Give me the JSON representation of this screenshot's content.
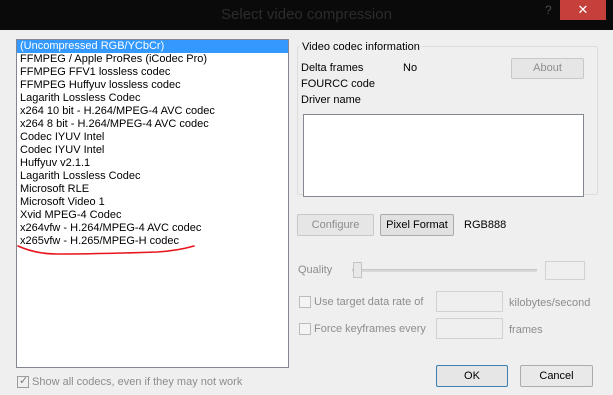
{
  "window": {
    "title": "Select video compression",
    "help_glyph": "?",
    "close_glyph": "✕"
  },
  "codecs": [
    "(Uncompressed RGB/YCbCr)",
    "FFMPEG / Apple ProRes (iCodec Pro)",
    "FFMPEG FFV1 lossless codec",
    "FFMPEG Huffyuv lossless codec",
    "Lagarith Lossless Codec",
    "x264 10 bit - H.264/MPEG-4 AVC codec",
    "x264 8 bit - H.264/MPEG-4 AVC codec",
    "Codec IYUV Intel",
    "Codec IYUV Intel",
    "Huffyuv v2.1.1",
    "Lagarith Lossless Codec",
    "Microsoft RLE",
    "Microsoft Video 1",
    "Xvid MPEG-4 Codec",
    "x264vfw - H.264/MPEG-4 AVC codec",
    "x265vfw - H.265/MPEG-H codec"
  ],
  "selected_index": 0,
  "info": {
    "group_label": "Video codec information",
    "delta_frames_label": "Delta frames",
    "delta_frames_value": "No",
    "fourcc_label": "FOURCC code",
    "driver_label": "Driver name",
    "about_label": "About"
  },
  "controls": {
    "configure_label": "Configure",
    "pixel_format_label": "Pixel Format",
    "pixel_format_value": "RGB888",
    "quality_label": "Quality",
    "target_rate_label": "Use target data rate of",
    "target_rate_unit": "kilobytes/second",
    "keyframes_label": "Force keyframes every",
    "keyframes_unit": "frames"
  },
  "footer": {
    "show_all_label": "Show all codecs, even if they may not work",
    "show_all_checked": true,
    "ok_label": "OK",
    "cancel_label": "Cancel"
  },
  "colors": {
    "selection": "#3399ff",
    "annotation": "#e8141b",
    "close_button": "#c6403b"
  }
}
